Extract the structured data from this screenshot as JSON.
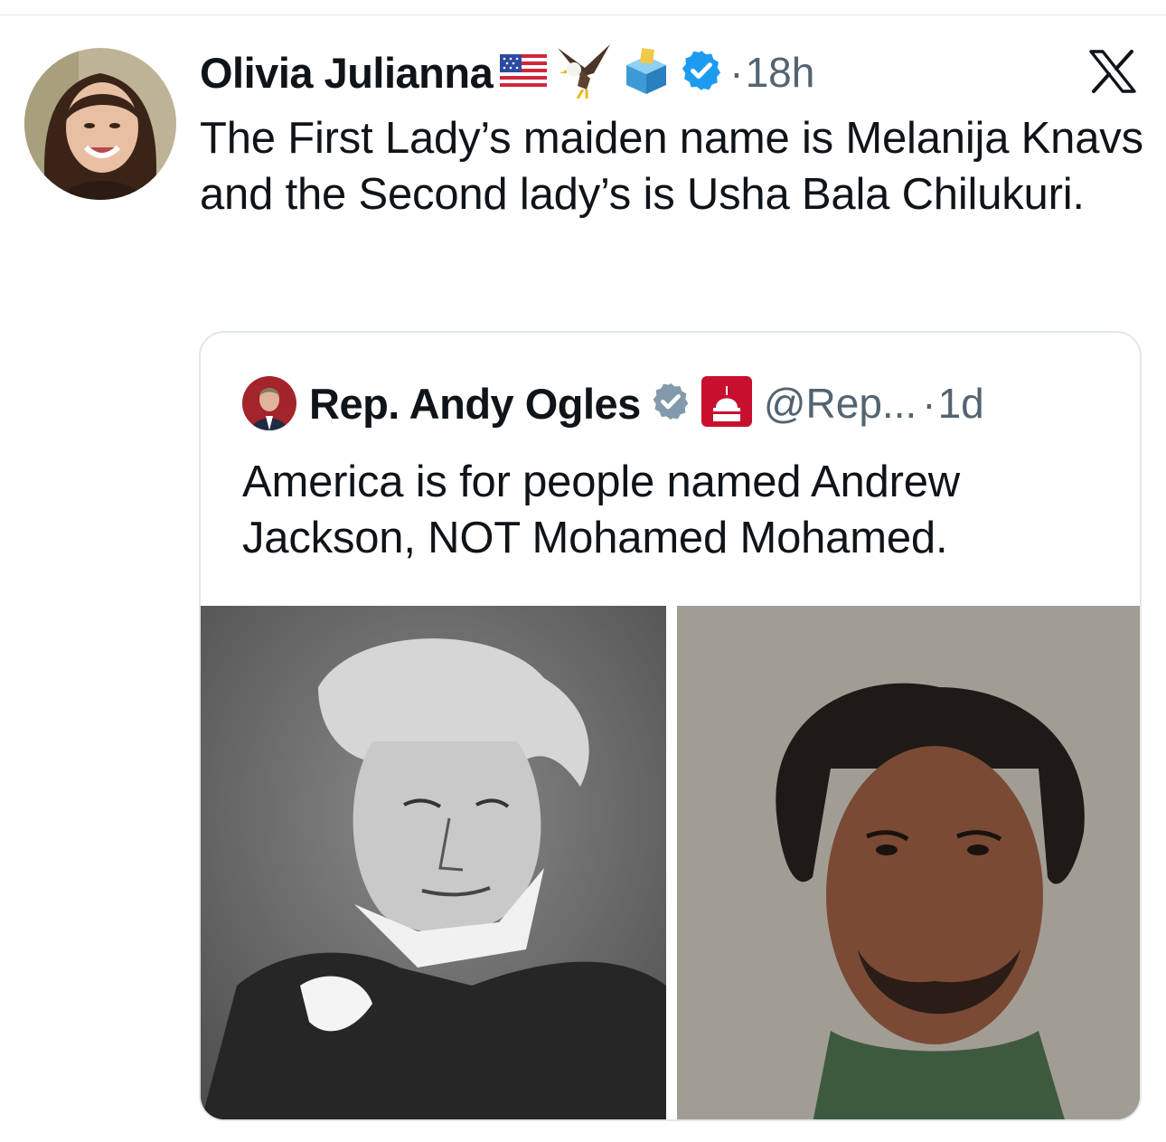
{
  "post": {
    "author_name": "Olivia Julianna",
    "emoji_badges": [
      "flag-us-icon",
      "eagle-icon",
      "ballot-box-icon"
    ],
    "separator": "·",
    "time": "18h",
    "text": "The First Lady’s maiden name is Melanija Knavs and the Second lady’s is Usha Bala Chilukuri."
  },
  "quote": {
    "author_name": "Rep. Andy Ogles",
    "handle": "@Rep...",
    "separator": "·",
    "time": "1d",
    "affiliation_badge": "house-gop-badge-icon",
    "text": "America is for people named Andrew Jackson, NOT Mohamed Mohamed.",
    "media": [
      "portrait-engraving",
      "mugshot-photo"
    ]
  },
  "colors": {
    "verified_blue": "#1d9bf0",
    "verified_gray": "#829aab",
    "secondary_text": "#536471",
    "gop_red": "#c8102e"
  }
}
